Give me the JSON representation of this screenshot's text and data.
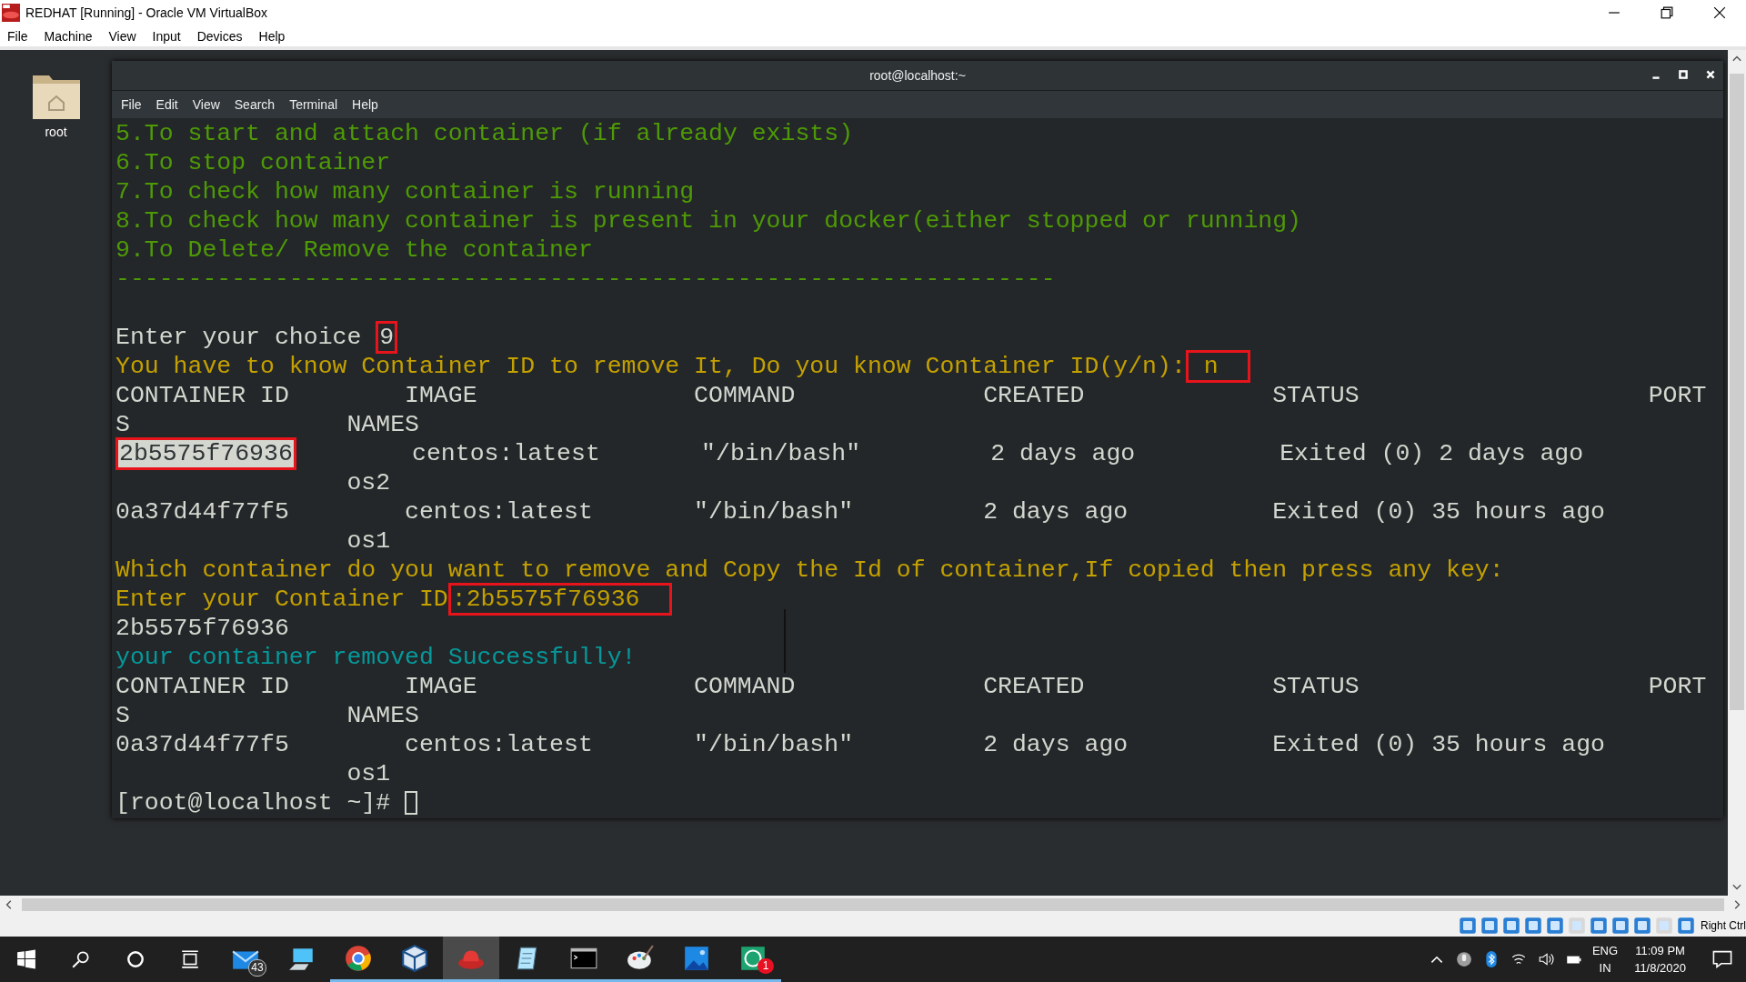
{
  "window": {
    "title": "REDHAT [Running] - Oracle VM VirtualBox"
  },
  "menu": [
    "File",
    "Machine",
    "View",
    "Input",
    "Devices",
    "Help"
  ],
  "desktop": {
    "icons": [
      {
        "label": "root"
      }
    ]
  },
  "terminal": {
    "title": "root@localhost:~",
    "menu": [
      "File",
      "Edit",
      "View",
      "Search",
      "Terminal",
      "Help"
    ],
    "lines": [
      {
        "segments": [
          {
            "text": "5.To start and attach container (if already exists)",
            "color": "#4e9a06"
          }
        ]
      },
      {
        "segments": [
          {
            "text": "6.To stop container",
            "color": "#4e9a06"
          }
        ]
      },
      {
        "segments": [
          {
            "text": "7.To check how many container is running",
            "color": "#4e9a06"
          }
        ]
      },
      {
        "segments": [
          {
            "text": "8.To check how many container is present in your docker(either stopped or running)",
            "color": "#4e9a06"
          }
        ]
      },
      {
        "segments": [
          {
            "text": "9.To Delete/ Remove the container",
            "color": "#4e9a06"
          }
        ]
      },
      {
        "segments": [
          {
            "text": "-----------------------------------------------------------------",
            "color": "#4e9a06"
          }
        ]
      },
      {
        "kind": "blank"
      },
      {
        "segments": [
          {
            "text": "Enter your choice ",
            "color": "#d3d7cf"
          },
          {
            "text": "9",
            "color": "#d3d7cf",
            "marked": true
          }
        ]
      },
      {
        "segments": [
          {
            "text": "You have to know Container ID to remove It, Do you know Container ID(y/n):",
            "color": "#c4a000"
          },
          {
            "text": " n  ",
            "color": "#c4a000",
            "marked": true
          }
        ]
      },
      {
        "segments": [
          {
            "text": "CONTAINER ID        IMAGE               COMMAND             CREATED             STATUS                    PORT",
            "color": "#d3d7cf"
          }
        ]
      },
      {
        "segments": [
          {
            "text": "S               NAMES",
            "color": "#d3d7cf"
          }
        ]
      },
      {
        "segments": [
          {
            "text": "2b5575f76936",
            "color": "#d3d7cf",
            "marked": true,
            "highlighted": true
          },
          {
            "text": "        centos:latest       \"/bin/bash\"         2 days ago          Exited (0) 2 days ago",
            "color": "#d3d7cf"
          }
        ]
      },
      {
        "segments": [
          {
            "text": "                os2",
            "color": "#d3d7cf"
          }
        ]
      },
      {
        "segments": [
          {
            "text": "0a37d44f77f5        centos:latest       \"/bin/bash\"         2 days ago          Exited (0) 35 hours ago",
            "color": "#d3d7cf"
          }
        ]
      },
      {
        "segments": [
          {
            "text": "                os1",
            "color": "#d3d7cf"
          }
        ]
      },
      {
        "segments": [
          {
            "text": "Which container do you want to remove and Copy the Id of container,If copied then press any key:",
            "color": "#c4a000"
          }
        ]
      },
      {
        "segments": [
          {
            "text": "Enter your Container ID",
            "color": "#c4a000"
          },
          {
            "text": ":2b5575f76936  ",
            "color": "#c4a000",
            "marked": true
          }
        ]
      },
      {
        "segments": [
          {
            "text": "2b5575f76936",
            "color": "#d3d7cf"
          }
        ]
      },
      {
        "segments": [
          {
            "text": "your container removed Successfully!",
            "color": "#06989a"
          }
        ]
      },
      {
        "segments": [
          {
            "text": "CONTAINER ID        IMAGE               COMMAND             CREATED             STATUS                    PORT",
            "color": "#d3d7cf"
          }
        ]
      },
      {
        "segments": [
          {
            "text": "S               NAMES",
            "color": "#d3d7cf"
          }
        ]
      },
      {
        "segments": [
          {
            "text": "0a37d44f77f5        centos:latest       \"/bin/bash\"         2 days ago          Exited (0) 35 hours ago",
            "color": "#d3d7cf"
          }
        ]
      },
      {
        "segments": [
          {
            "text": "                os1",
            "color": "#d3d7cf"
          }
        ]
      },
      {
        "kind": "prompt",
        "segments": [
          {
            "text": "[root@localhost ~]# ",
            "color": "#d3d7cf"
          }
        ]
      }
    ]
  },
  "vm_status": {
    "host_key": "Right Ctrl"
  },
  "taskbar": {
    "apps": [
      {
        "kind": "mail",
        "badge": "43",
        "running": false,
        "active": false
      },
      {
        "kind": "computer",
        "running": false,
        "active": false
      },
      {
        "kind": "browser",
        "running": true,
        "active": false
      },
      {
        "kind": "cube",
        "running": true,
        "active": false
      },
      {
        "kind": "hat",
        "running": true,
        "active": true
      },
      {
        "kind": "notepad",
        "running": true,
        "active": false
      },
      {
        "kind": "console",
        "running": true,
        "active": false
      },
      {
        "kind": "paint",
        "running": true,
        "active": false
      },
      {
        "kind": "photos",
        "running": true,
        "active": false
      },
      {
        "kind": "chat",
        "badge": "1",
        "running": true,
        "active": false
      }
    ],
    "tray": {
      "language": "ENG",
      "region": "IN",
      "time": "11:09 PM",
      "date": "11/8/2020"
    }
  }
}
